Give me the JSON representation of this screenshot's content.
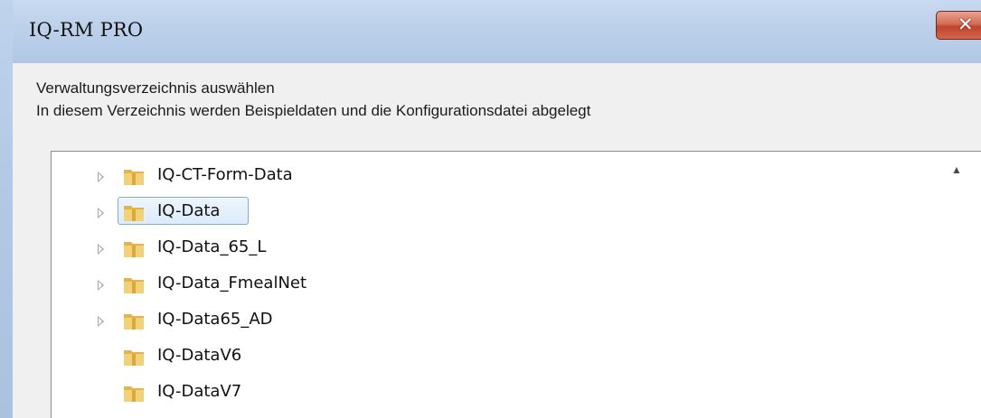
{
  "window": {
    "title": "IQ-RM PRO",
    "close_label": "✕"
  },
  "dialog": {
    "description_line1": "Verwaltungsverzeichnis auswählen",
    "description_line2": "In diesem Verzeichnis werden Beispieldaten und die Konfigurationsdatei abgelegt"
  },
  "tree": {
    "scroll_up_glyph": "▲",
    "folders": [
      {
        "label": "IQ-CT-Form-Data",
        "expandable": true,
        "selected": false
      },
      {
        "label": "IQ-Data",
        "expandable": true,
        "selected": true
      },
      {
        "label": "IQ-Data_65_L",
        "expandable": true,
        "selected": false
      },
      {
        "label": "IQ-Data_FmealNet",
        "expandable": true,
        "selected": false
      },
      {
        "label": "IQ-Data65_AD",
        "expandable": true,
        "selected": false
      },
      {
        "label": "IQ-DataV6",
        "expandable": false,
        "selected": false
      },
      {
        "label": "IQ-DataV7",
        "expandable": false,
        "selected": false
      }
    ]
  },
  "colors": {
    "titlebar": "#bcd0ea",
    "close_button": "#c7452c",
    "selection_border": "#84acdd",
    "folder": "#e9c25a"
  }
}
